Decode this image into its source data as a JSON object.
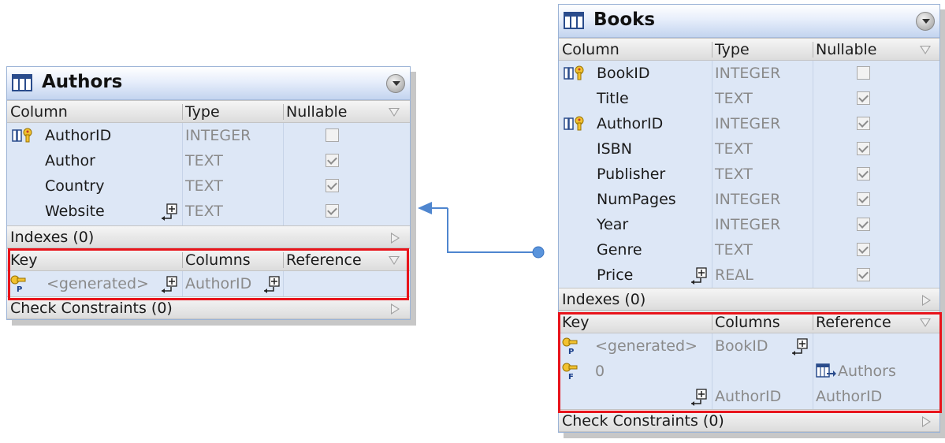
{
  "authors": {
    "name": "Authors",
    "column_headers": {
      "column": "Column",
      "type": "Type",
      "nullable": "Nullable"
    },
    "columns": [
      {
        "name": "AuthorID",
        "type": "INTEGER",
        "nullable": false,
        "key_icon": "primary-key-column-icon"
      },
      {
        "name": "Author",
        "type": "TEXT",
        "nullable": true
      },
      {
        "name": "Country",
        "type": "TEXT",
        "nullable": true
      },
      {
        "name": "Website",
        "type": "TEXT",
        "nullable": true,
        "expand_icon": "expand-icon"
      }
    ],
    "indexes_label": "Indexes (0)",
    "key_headers": {
      "key": "Key",
      "columns": "Columns",
      "reference": "Reference"
    },
    "keys": [
      {
        "type_icon": "primary-key-icon",
        "name": "<generated>",
        "columns": "AuthorID",
        "reference": ""
      }
    ],
    "check_label": "Check Constraints (0)"
  },
  "books": {
    "name": "Books",
    "column_headers": {
      "column": "Column",
      "type": "Type",
      "nullable": "Nullable"
    },
    "columns": [
      {
        "name": "BookID",
        "type": "INTEGER",
        "nullable": false,
        "key_icon": "primary-key-column-icon"
      },
      {
        "name": "Title",
        "type": "TEXT",
        "nullable": true
      },
      {
        "name": "AuthorID",
        "type": "INTEGER",
        "nullable": true,
        "key_icon": "foreign-key-column-icon"
      },
      {
        "name": "ISBN",
        "type": "TEXT",
        "nullable": true
      },
      {
        "name": "Publisher",
        "type": "TEXT",
        "nullable": true
      },
      {
        "name": "NumPages",
        "type": "INTEGER",
        "nullable": true
      },
      {
        "name": "Year",
        "type": "INTEGER",
        "nullable": true
      },
      {
        "name": "Genre",
        "type": "TEXT",
        "nullable": true
      },
      {
        "name": "Price",
        "type": "REAL",
        "nullable": true,
        "expand_icon": "expand-icon"
      }
    ],
    "indexes_label": "Indexes (0)",
    "key_headers": {
      "key": "Key",
      "columns": "Columns",
      "reference": "Reference"
    },
    "keys": [
      {
        "type_icon": "primary-key-icon",
        "name": "<generated>",
        "columns": "BookID",
        "reference": ""
      },
      {
        "type_icon": "foreign-key-icon",
        "name": "0",
        "columns": "",
        "reference": "Authors"
      },
      {
        "name": "",
        "columns": "AuthorID",
        "reference": "AuthorID"
      }
    ],
    "check_label": "Check Constraints (0)"
  },
  "colors": {
    "table_body": "#dde7f6",
    "header_gradient_end": "#c3d4ef",
    "highlight_border": "#e8141b",
    "relation_line": "#4f86cf"
  }
}
